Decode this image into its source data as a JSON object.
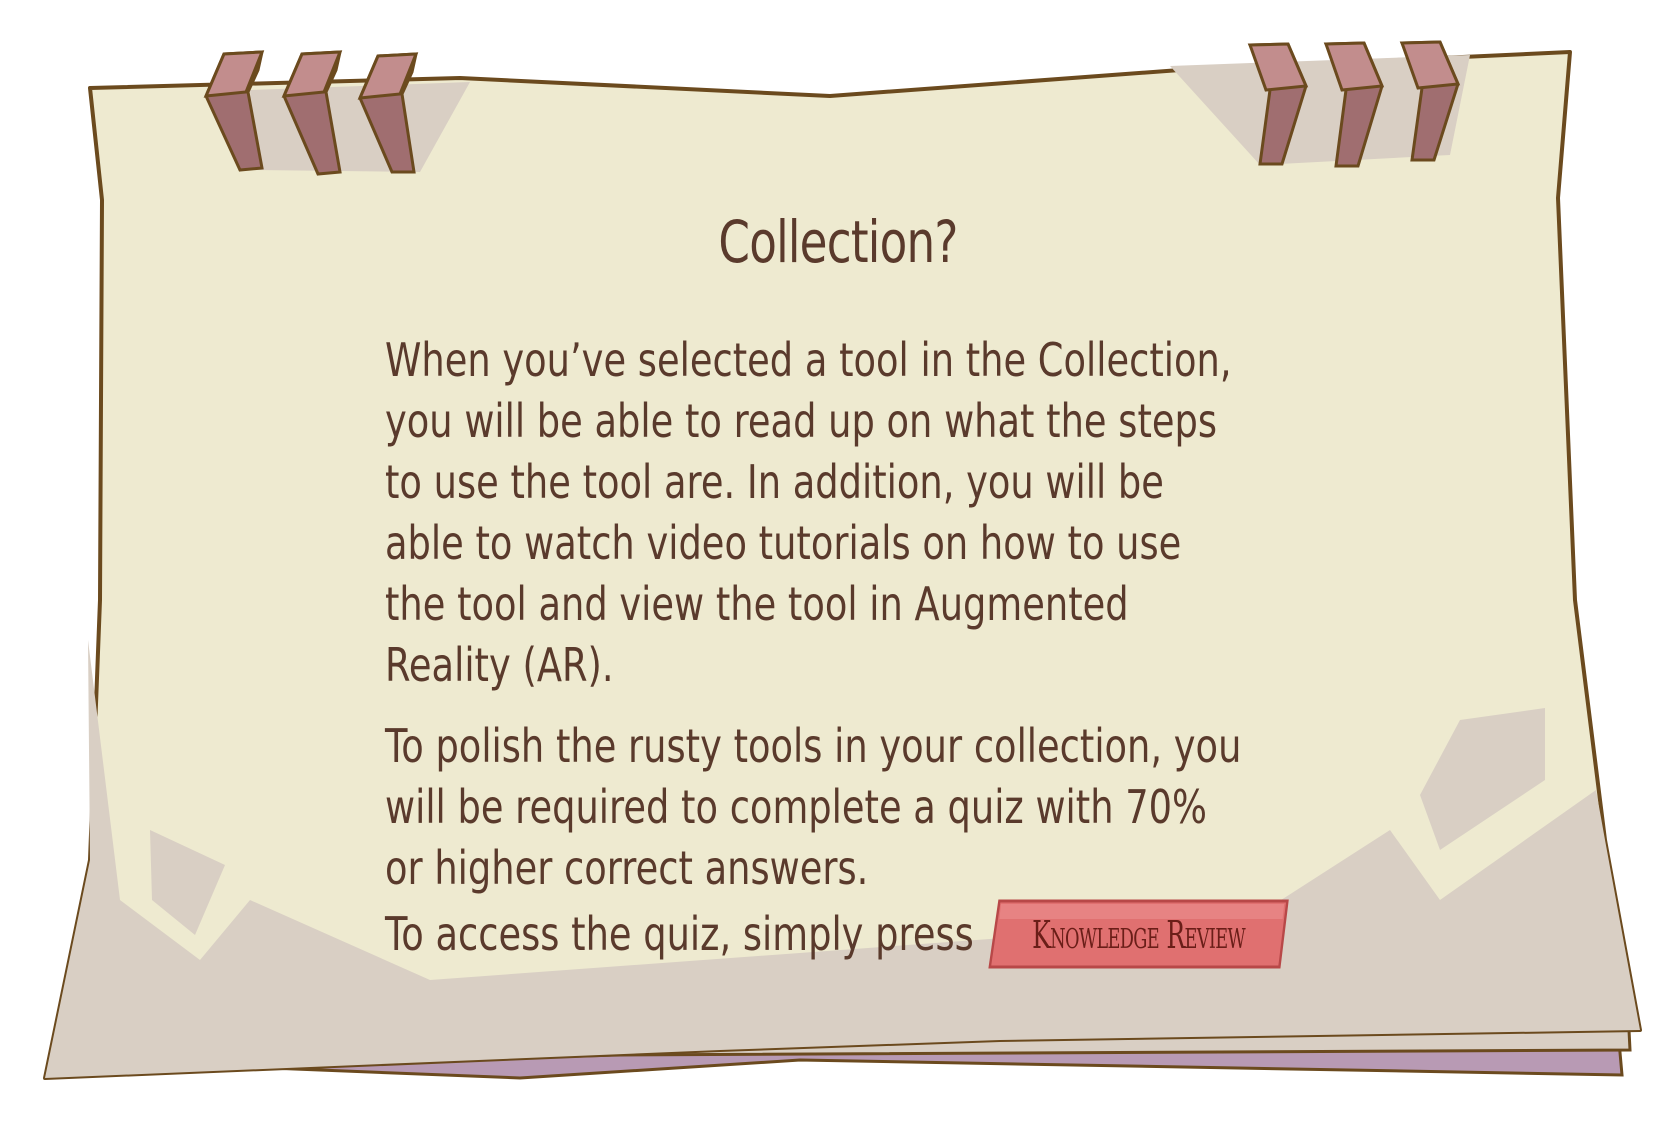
{
  "dialog": {
    "title": "Collection?",
    "paragraphs": [
      "When you’ve selected a tool in the Collection, you will be able to read up on what the steps to use the tool are. In addition, you will be able to watch video tutorials on how to use the tool and view the tool in Augmented Reality (AR).",
      "To polish the rusty tools in your collection, you will be required to complete a quiz with 70% or higher correct answers."
    ],
    "access_text": "To access the quiz, simply press",
    "knowledge_review_label": "Knowledge Review"
  },
  "colors": {
    "paper": "#eeead0",
    "paper_shadow": "#d9cfc4",
    "outline": "#6b4a1e",
    "lower_sheet": "#b89ab4",
    "clip": "#a06e70",
    "text": "#5a3a2c",
    "button_fill": "#e07070",
    "button_text": "#6a1e18"
  },
  "icons": {
    "binder_clips_left": "binder-clip-icon",
    "binder_clips_right": "binder-clip-icon"
  }
}
